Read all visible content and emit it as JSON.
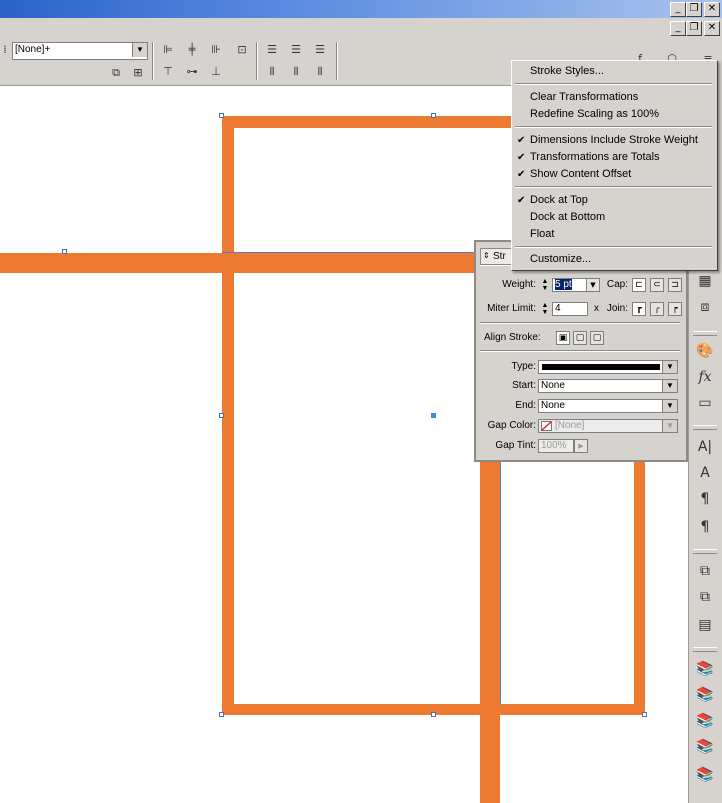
{
  "colors": {
    "accent_orange": "#ec7a30",
    "chrome": "#d6d3ce",
    "title_blue": "#2a63c9"
  },
  "toolbar": {
    "style_value": "[None]+"
  },
  "menu": {
    "items": [
      {
        "label": "Stroke Styles...",
        "checked": false
      },
      {
        "label": "Clear Transformations",
        "checked": false
      },
      {
        "label": "Redefine Scaling as 100%",
        "checked": false
      },
      {
        "label": "Dimensions Include Stroke Weight",
        "checked": true
      },
      {
        "label": "Transformations are Totals",
        "checked": true
      },
      {
        "label": "Show Content Offset",
        "checked": true
      },
      {
        "label": "Dock at Top",
        "checked": true
      },
      {
        "label": "Dock at Bottom",
        "checked": false
      },
      {
        "label": "Float",
        "checked": false
      },
      {
        "label": "Customize...",
        "checked": false
      }
    ],
    "check_glyph": "✔"
  },
  "stroke_panel": {
    "tab_label": "Str",
    "weight_label": "Weight:",
    "weight_value": "5 pt",
    "cap_label": "Cap:",
    "miter_label": "Miter Limit:",
    "miter_value": "4",
    "miter_unit": "x",
    "join_label": "Join:",
    "align_label": "Align Stroke:",
    "type_label": "Type:",
    "start_label": "Start:",
    "start_value": "None",
    "end_label": "End:",
    "end_value": "None",
    "gap_color_label": "Gap Color:",
    "gap_color_value": "[None]",
    "gap_tint_label": "Gap Tint:",
    "gap_tint_value": "100%"
  },
  "window_buttons": {
    "minimize": "_",
    "restore": "🗗",
    "close": "✕"
  }
}
